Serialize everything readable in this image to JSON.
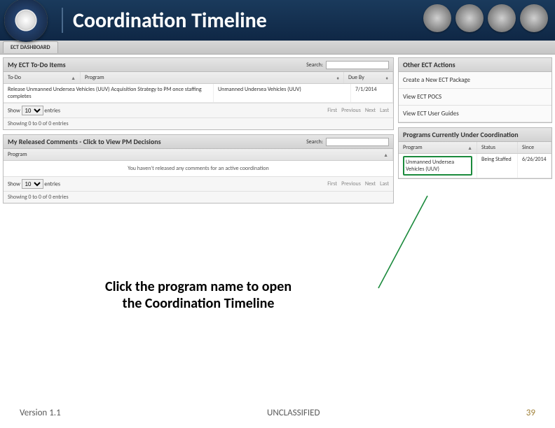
{
  "header": {
    "title": "Coordination Timeline"
  },
  "dashboard": {
    "tab": "ECT DASHBOARD",
    "todo": {
      "title": "My ECT To-Do Items",
      "search_label": "Search:",
      "cols": {
        "todo": "To-Do",
        "program": "Program",
        "due": "Due By"
      },
      "rows": [
        {
          "todo": "Release Unmanned Undersea Vehicles (UUV) Acquisition Strategy to PM once staffing completes",
          "program": "Unmanned Undersea Vehicles (UUV)",
          "due": "7/1/2014"
        }
      ],
      "show_prefix": "Show",
      "show_value": "10",
      "show_suffix": "entries",
      "showing": "Showing 0 to 0 of 0 entries",
      "pager": {
        "first": "First",
        "prev": "Previous",
        "next": "Next",
        "last": "Last"
      }
    },
    "released": {
      "title": "My Released Comments - Click to View PM Decisions",
      "search_label": "Search:",
      "col_program": "Program",
      "empty": "You haven't released any comments for an active coordination",
      "show_prefix": "Show",
      "show_value": "10",
      "show_suffix": "entries",
      "showing": "Showing 0 to 0 of 0 entries",
      "pager": {
        "first": "First",
        "prev": "Previous",
        "next": "Next",
        "last": "Last"
      }
    },
    "actions": {
      "title": "Other ECT Actions",
      "links": [
        "Create a New ECT Package",
        "View ECT POCS",
        "View ECT User Guides"
      ]
    },
    "programs": {
      "title": "Programs Currently Under Coordination",
      "cols": {
        "program": "Program",
        "status": "Status",
        "since": "Since"
      },
      "rows": [
        {
          "program": "Unmanned Undersea Vehicles (UUV)",
          "status": "Being Staffed",
          "since": "6/26/2014"
        }
      ]
    }
  },
  "annotation": {
    "line1": "Click the program name to open",
    "line2": "the Coordination Timeline"
  },
  "footer": {
    "version": "Version 1.1",
    "classification": "UNCLASSIFIED",
    "page": "39"
  }
}
